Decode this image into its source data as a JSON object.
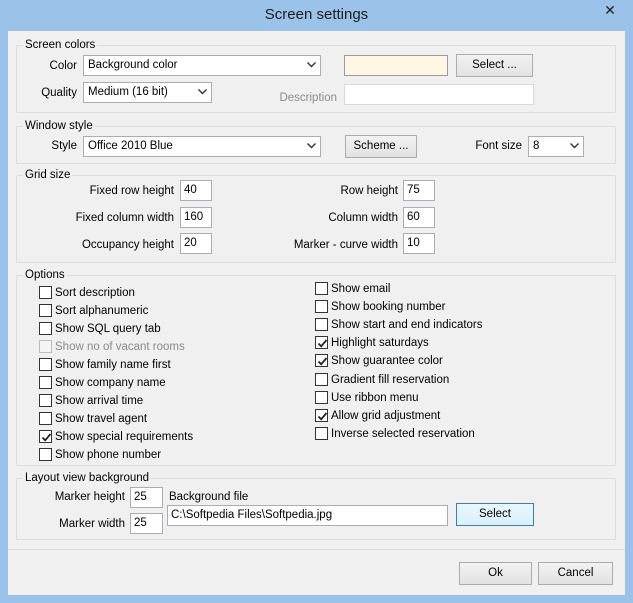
{
  "window": {
    "title": "Screen settings",
    "close_glyph": "✕"
  },
  "screen_colors": {
    "title": "Screen colors",
    "color_label": "Color",
    "color_value": "Background color",
    "quality_label": "Quality",
    "quality_value": "Medium (16 bit)",
    "select_button": "Select ...",
    "description_label": "Description",
    "description_value": "",
    "swatch_color": "#fff6e3"
  },
  "window_style": {
    "title": "Window style",
    "style_label": "Style",
    "style_value": "Office 2010 Blue",
    "scheme_button": "Scheme ...",
    "font_size_label": "Font size",
    "font_size_value": "8"
  },
  "grid_size": {
    "title": "Grid size",
    "fixed_row_height_label": "Fixed row height",
    "fixed_row_height": "40",
    "fixed_column_width_label": "Fixed column width",
    "fixed_column_width": "160",
    "occupancy_height_label": "Occupancy height",
    "occupancy_height": "20",
    "row_height_label": "Row height",
    "row_height": "75",
    "column_width_label": "Column width",
    "column_width": "60",
    "marker_curve_width_label": "Marker - curve width",
    "marker_curve_width": "10"
  },
  "options": {
    "title": "Options",
    "left": [
      {
        "label": "Sort description",
        "checked": false,
        "disabled": false
      },
      {
        "label": "Sort alphanumeric",
        "checked": false,
        "disabled": false
      },
      {
        "label": "Show SQL query tab",
        "checked": false,
        "disabled": false
      },
      {
        "label": "Show no of vacant rooms",
        "checked": false,
        "disabled": true
      },
      {
        "label": "Show family name first",
        "checked": false,
        "disabled": false
      },
      {
        "label": "Show company name",
        "checked": false,
        "disabled": false
      },
      {
        "label": "Show arrival time",
        "checked": false,
        "disabled": false
      },
      {
        "label": "Show travel agent",
        "checked": false,
        "disabled": false
      },
      {
        "label": "Show special requirements",
        "checked": true,
        "disabled": false
      },
      {
        "label": "Show phone number",
        "checked": false,
        "disabled": false
      }
    ],
    "right": [
      {
        "label": "Show email",
        "checked": false,
        "disabled": false
      },
      {
        "label": "Show booking number",
        "checked": false,
        "disabled": false
      },
      {
        "label": "Show start and end indicators",
        "checked": false,
        "disabled": false
      },
      {
        "label": "Highlight saturdays",
        "checked": true,
        "disabled": false
      },
      {
        "label": "Show guarantee color",
        "checked": true,
        "disabled": false
      },
      {
        "label": "Gradient fill reservation",
        "checked": false,
        "disabled": false
      },
      {
        "label": "Use ribbon menu",
        "checked": false,
        "disabled": false
      },
      {
        "label": "Allow grid adjustment",
        "checked": true,
        "disabled": false
      },
      {
        "label": "Inverse selected reservation",
        "checked": false,
        "disabled": false
      }
    ]
  },
  "layout_view": {
    "title": "Layout view background",
    "marker_height_label": "Marker height",
    "marker_height": "25",
    "marker_width_label": "Marker width",
    "marker_width": "25",
    "background_file_label": "Background file",
    "background_file": "C:\\Softpedia Files\\Softpedia.jpg",
    "select_button": "Select"
  },
  "footer": {
    "ok_button": "Ok",
    "cancel_button": "Cancel"
  }
}
